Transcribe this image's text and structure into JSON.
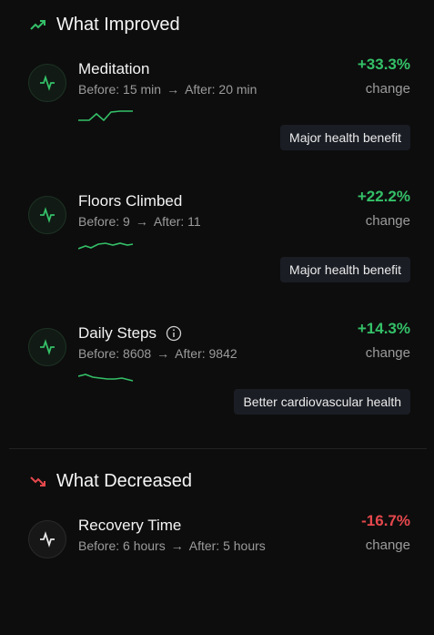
{
  "improved": {
    "title": "What Improved",
    "items": [
      {
        "name": "Meditation",
        "before": "Before: 15 min",
        "after": "After: 20 min",
        "pct": "+33.3%",
        "change": "change",
        "tag": "Major health benefit",
        "icon": "activity-icon"
      },
      {
        "name": "Floors Climbed",
        "before": "Before: 9",
        "after": "After: 11",
        "pct": "+22.2%",
        "change": "change",
        "tag": "Major health benefit",
        "icon": "activity-icon"
      },
      {
        "name": "Daily Steps",
        "before": "Before: 8608",
        "after": "After: 9842",
        "pct": "+14.3%",
        "change": "change",
        "tag": "Better cardiovascular health",
        "icon": "activity-icon",
        "has_info": true
      }
    ]
  },
  "decreased": {
    "title": "What Decreased",
    "items": [
      {
        "name": "Recovery Time",
        "before": "Before: 6 hours",
        "after": "After: 5 hours",
        "pct": "-16.7%",
        "change": "change",
        "icon": "activity-icon"
      }
    ]
  },
  "colors": {
    "up": "#34c068",
    "down": "#e5484d",
    "tag_bg": "#1a1d24"
  }
}
